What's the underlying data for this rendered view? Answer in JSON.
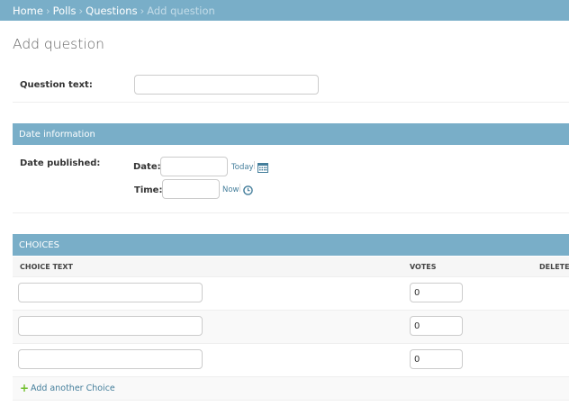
{
  "breadcrumbs": {
    "items": [
      "Home",
      "Polls",
      "Questions"
    ],
    "separator": "›",
    "current": "Add question"
  },
  "page_title": "Add question",
  "question": {
    "label": "Question text:",
    "value": ""
  },
  "date_section": {
    "title": "Date information",
    "field_label": "Date published:",
    "date_label": "Date:",
    "date_value": "",
    "today_link": "Today",
    "time_label": "Time:",
    "time_value": "",
    "now_link": "Now"
  },
  "choices": {
    "title": "CHOICES",
    "columns": [
      "CHOICE TEXT",
      "VOTES",
      "DELETE?"
    ],
    "rows": [
      {
        "choice_text": "",
        "votes": "0"
      },
      {
        "choice_text": "",
        "votes": "0"
      },
      {
        "choice_text": "",
        "votes": "0"
      }
    ],
    "add_another": "Add another Choice"
  },
  "colors": {
    "header_bg": "#79aec8",
    "link": "#447e9b",
    "add_icon": "#70bf2b"
  }
}
